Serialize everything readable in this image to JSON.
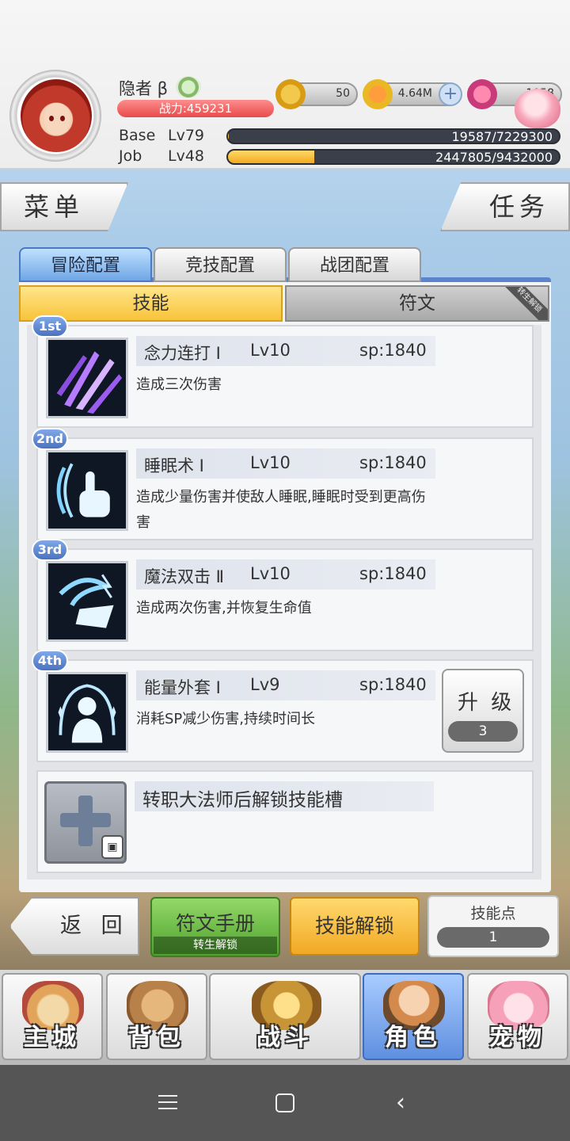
{
  "player": {
    "name": "隐者 β",
    "power_label": "战力:459231",
    "base_label": "Base",
    "base_level": "Lv79",
    "base_exp": "19587/7229300",
    "base_exp_fraction": 0.003,
    "job_label": "Job",
    "job_level": "Lv48",
    "job_exp": "2447805/9432000",
    "job_exp_fraction": 0.26
  },
  "currencies": {
    "zeny": "50",
    "gold": "4.64M",
    "gem": "1058"
  },
  "side_buttons": {
    "menu": "菜单",
    "task": "任务"
  },
  "tabs": [
    "冒险配置",
    "竞技配置",
    "战团配置"
  ],
  "subtabs": {
    "skill": "技能",
    "rune": "符文",
    "rune_ribbon": "转生解锁"
  },
  "skills": [
    {
      "rank": "1st",
      "name": "念力连打 Ⅰ",
      "level": "Lv10",
      "sp": "sp:1840",
      "desc": "造成三次伤害",
      "icon": "purple-slash-icon"
    },
    {
      "rank": "2nd",
      "name": "睡眠术 Ⅰ",
      "level": "Lv10",
      "sp": "sp:1840",
      "desc": "造成少量伤害并使敌人睡眠,睡眠时受到更高伤害",
      "icon": "sleep-hand-icon"
    },
    {
      "rank": "3rd",
      "name": "魔法双击 Ⅱ",
      "level": "Lv10",
      "sp": "sp:1840",
      "desc": "造成两次伤害,并恢复生命值",
      "icon": "double-hit-icon"
    },
    {
      "rank": "4th",
      "name": "能量外套 Ⅰ",
      "level": "Lv9",
      "sp": "sp:1840",
      "desc": "消耗SP减少伤害,持续时间长",
      "icon": "energy-coat-icon"
    }
  ],
  "upgrade": {
    "label": "升 级",
    "count": "3"
  },
  "locked_slot_text": "转职大法师后解锁技能槽",
  "actions": {
    "back": "返 回",
    "rune_manual": "符文手册",
    "rune_manual_lock": "转生解锁",
    "skill_unlock": "技能解锁",
    "skill_points_label": "技能点",
    "skill_points": "1"
  },
  "nav": [
    "主城",
    "背包",
    "战斗",
    "角色",
    "宠物"
  ],
  "colors": {
    "accent_blue": "#5b84cd",
    "active_yellow": "#f8c43a",
    "power_red": "#e84a4a",
    "exp_gold": "#f2a91e"
  }
}
